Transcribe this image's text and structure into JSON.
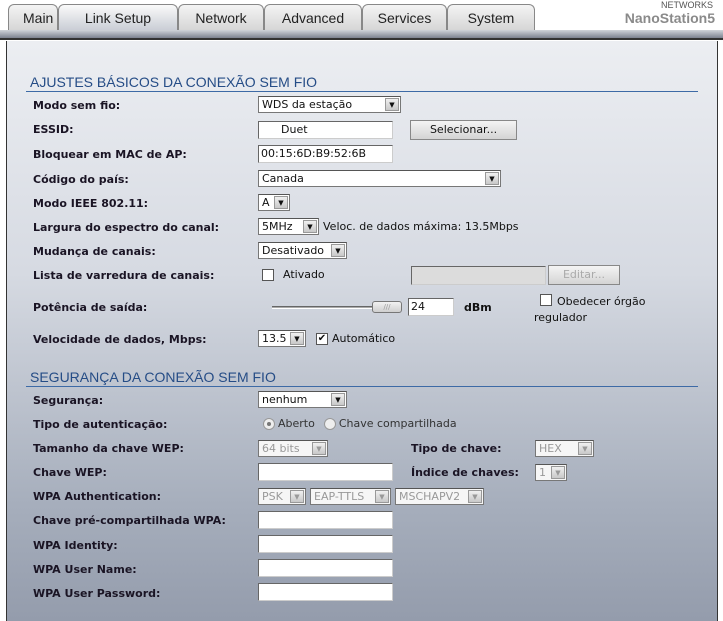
{
  "header": {
    "brand": "NanoStation5",
    "brand_small": "NETWORKS",
    "tabs": [
      "Main",
      "Link Setup",
      "Network",
      "Advanced",
      "Services",
      "System"
    ],
    "active_tab": "Link Setup"
  },
  "basic": {
    "title": "AJUSTES BÁSICOS DA CONEXÃO SEM FIO",
    "modo_label": "Modo sem fio:",
    "modo_value": "WDS da estação",
    "essid_label": "ESSID:",
    "essid_value": "Duet",
    "select_button": "Selecionar...",
    "mac_label": "Bloquear em MAC de AP:",
    "mac_value": "00:15:6D:B9:52:6B",
    "pais_label": "Código do país:",
    "pais_value": "Canada",
    "ieee_label": "Modo IEEE 802.11:",
    "ieee_value": "A",
    "largura_label": "Largura do espectro do canal:",
    "largura_value": "5MHz",
    "max_rate": "Veloc. de dados máxima: 13.5Mbps",
    "mudanca_label": "Mudança de canais:",
    "mudanca_value": "Desativado",
    "lista_label": "Lista de varredura de canais:",
    "lista_check": "Ativado",
    "lista_checked": false,
    "edit_button": "Editar...",
    "potencia_label": "Potência de saída:",
    "potencia_value": "24",
    "potencia_unit": "dBm",
    "potencia_slider_fraction": 1.0,
    "obedecer_label": "Obedecer órgão regulador",
    "obedecer_checked": false,
    "velocidade_label": "Velocidade de dados, Mbps:",
    "velocidade_value": "13.5",
    "auto_label": "Automático",
    "auto_checked": true
  },
  "security": {
    "title": "SEGURANÇA DA CONEXÃO SEM FIO",
    "seg_label": "Segurança:",
    "seg_value": "nenhum",
    "auth_label": "Tipo de autenticação:",
    "auth_open": "Aberto",
    "auth_shared": "Chave compartilhada",
    "wep_size_label": "Tamanho da chave WEP:",
    "wep_size_value": "64 bits",
    "key_type_label": "Tipo de chave:",
    "key_type_value": "HEX",
    "wep_key_label": "Chave WEP:",
    "key_index_label": "Índice de chaves:",
    "key_index_value": "1",
    "wpa_auth_label": "WPA Authentication:",
    "wpa_auth_values": [
      "PSK",
      "EAP-TTLS",
      "MSCHAPV2"
    ],
    "wpa_psk_label": "Chave pré-compartilhada WPA:",
    "wpa_identity_label": "WPA Identity:",
    "wpa_user_label": "WPA User Name:",
    "wpa_pass_label": "WPA User Password:"
  }
}
